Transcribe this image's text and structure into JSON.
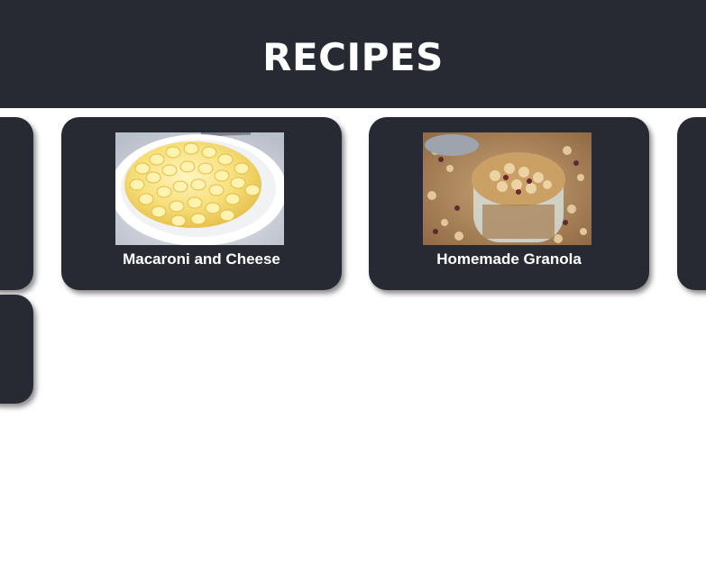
{
  "header": {
    "title": "RECIPES"
  },
  "recipes": [
    {
      "title": "Macaroni and Cheese",
      "image": "macaroni-and-cheese-photo"
    },
    {
      "title": "Homemade Granola",
      "image": "homemade-granola-photo"
    }
  ],
  "colors": {
    "header_bg": "#272a33",
    "card_bg": "#272a33",
    "card_text": "#ffffff",
    "page_bg": "#ffffff"
  }
}
